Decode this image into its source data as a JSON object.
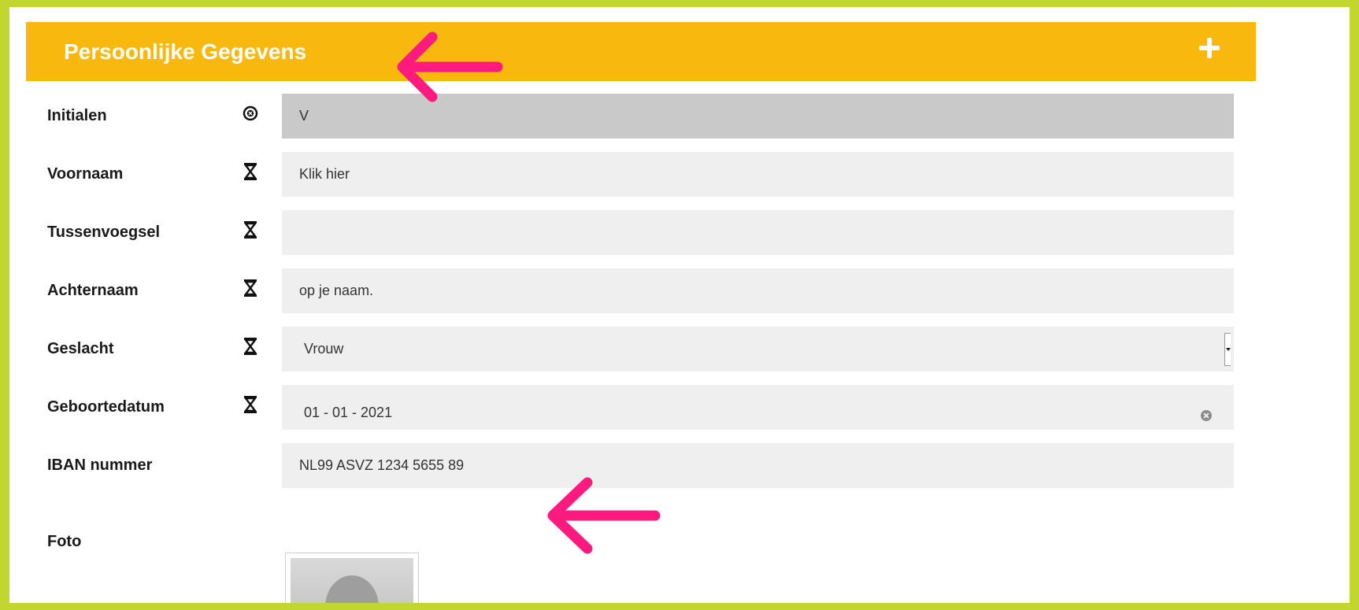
{
  "section": {
    "title": "Persoonlijke Gegevens",
    "toggle_icon": "plus-icon"
  },
  "fields": [
    {
      "label": "Initialen",
      "icon": "circle-x-icon",
      "value": "V",
      "state": "disabled"
    },
    {
      "label": "Voornaam",
      "icon": "hourglass-icon",
      "value": "Klik hier",
      "state": "text"
    },
    {
      "label": "Tussenvoegsel",
      "icon": "hourglass-icon",
      "value": "",
      "state": "text"
    },
    {
      "label": "Achternaam",
      "icon": "hourglass-icon",
      "value": "op je naam.",
      "state": "text"
    },
    {
      "label": "Geslacht",
      "icon": "hourglass-icon",
      "value": "Vrouw",
      "state": "select"
    },
    {
      "label": "Geboortedatum",
      "icon": "hourglass-icon",
      "value": "01 - 01 - 2021",
      "state": "date"
    },
    {
      "label": "IBAN nummer",
      "icon": "",
      "value": "NL99 ASVZ 1234 5655 89",
      "state": "text"
    },
    {
      "label": "Foto",
      "icon": "",
      "value": "",
      "state": "photo"
    }
  ],
  "colors": {
    "outer_border": "#c1d72f",
    "header": "#f8b80d",
    "annotation_arrow": "#ff1a7f",
    "field_bg": "#efefef",
    "field_disabled_bg": "#c9c9c9"
  }
}
